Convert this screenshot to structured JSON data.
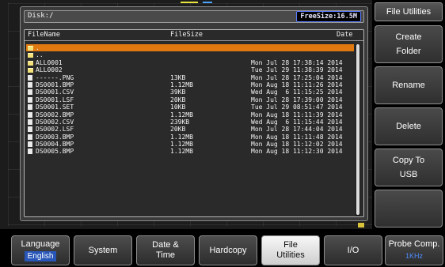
{
  "window": {
    "path": "Disk:/",
    "free_size": "FreeSize:16.5M"
  },
  "list": {
    "headers": {
      "name": "FileName",
      "size": "FileSize",
      "date": "Date"
    },
    "rows": [
      {
        "type": "folder",
        "name": ".",
        "size": "",
        "date": "",
        "selected": true
      },
      {
        "type": "folder",
        "name": "..",
        "size": "",
        "date": "",
        "selected": false
      },
      {
        "type": "folder",
        "name": "ALL0001",
        "size": "",
        "date": "Mon Jul 28 17:38:14 2014",
        "selected": false
      },
      {
        "type": "folder",
        "name": "ALL0002",
        "size": "",
        "date": "Tue Jul 29 11:38:39 2014",
        "selected": false
      },
      {
        "type": "file",
        "name": "------.PNG",
        "size": "13KB",
        "date": "Mon Jul 28 17:25:04 2014",
        "selected": false
      },
      {
        "type": "file",
        "name": "DS0001.BMP",
        "size": "1.12MB",
        "date": "Mon Aug 18 11:11:26 2014",
        "selected": false
      },
      {
        "type": "file",
        "name": "DS0001.CSV",
        "size": "39KB",
        "date": "Wed Aug  6 11:15:25 2014",
        "selected": false
      },
      {
        "type": "file",
        "name": "DS0001.LSF",
        "size": "20KB",
        "date": "Mon Jul 28 17:39:00 2014",
        "selected": false
      },
      {
        "type": "file",
        "name": "DS0001.SET",
        "size": "10KB",
        "date": "Tue Jul 29 08:51:47 2014",
        "selected": false
      },
      {
        "type": "file",
        "name": "DS0002.BMP",
        "size": "1.12MB",
        "date": "Mon Aug 18 11:11:39 2014",
        "selected": false
      },
      {
        "type": "file",
        "name": "DS0002.CSV",
        "size": "239KB",
        "date": "Wed Aug  6 11:15:44 2014",
        "selected": false
      },
      {
        "type": "file",
        "name": "DS0002.LSF",
        "size": "20KB",
        "date": "Mon Jul 28 17:44:04 2014",
        "selected": false
      },
      {
        "type": "file",
        "name": "DS0003.BMP",
        "size": "1.12MB",
        "date": "Mon Aug 18 11:11:48 2014",
        "selected": false
      },
      {
        "type": "file",
        "name": "DS0004.BMP",
        "size": "1.12MB",
        "date": "Mon Aug 18 11:12:02 2014",
        "selected": false
      },
      {
        "type": "file",
        "name": "DS0005.BMP",
        "size": "1.12MB",
        "date": "Mon Aug 18 11:12:30 2014",
        "selected": false
      }
    ]
  },
  "side_menu": {
    "title": "File Utilities",
    "buttons": [
      "Create\nFolder",
      "Rename",
      "Delete",
      "Copy To\nUSB",
      ""
    ]
  },
  "bottom_menu": [
    {
      "label": "Language",
      "sub": "English"
    },
    {
      "label": "System",
      "sub": ""
    },
    {
      "label": "Date &\nTime",
      "sub": ""
    },
    {
      "label": "Hardcopy",
      "sub": ""
    },
    {
      "label": "File\nUtilities",
      "sub": "",
      "active": true
    },
    {
      "label": "I/O",
      "sub": ""
    },
    {
      "label": "Probe Comp.",
      "sub": "1KHz"
    }
  ],
  "colors": {
    "selection": "#e07a10",
    "accent_blue": "#2756b8"
  }
}
